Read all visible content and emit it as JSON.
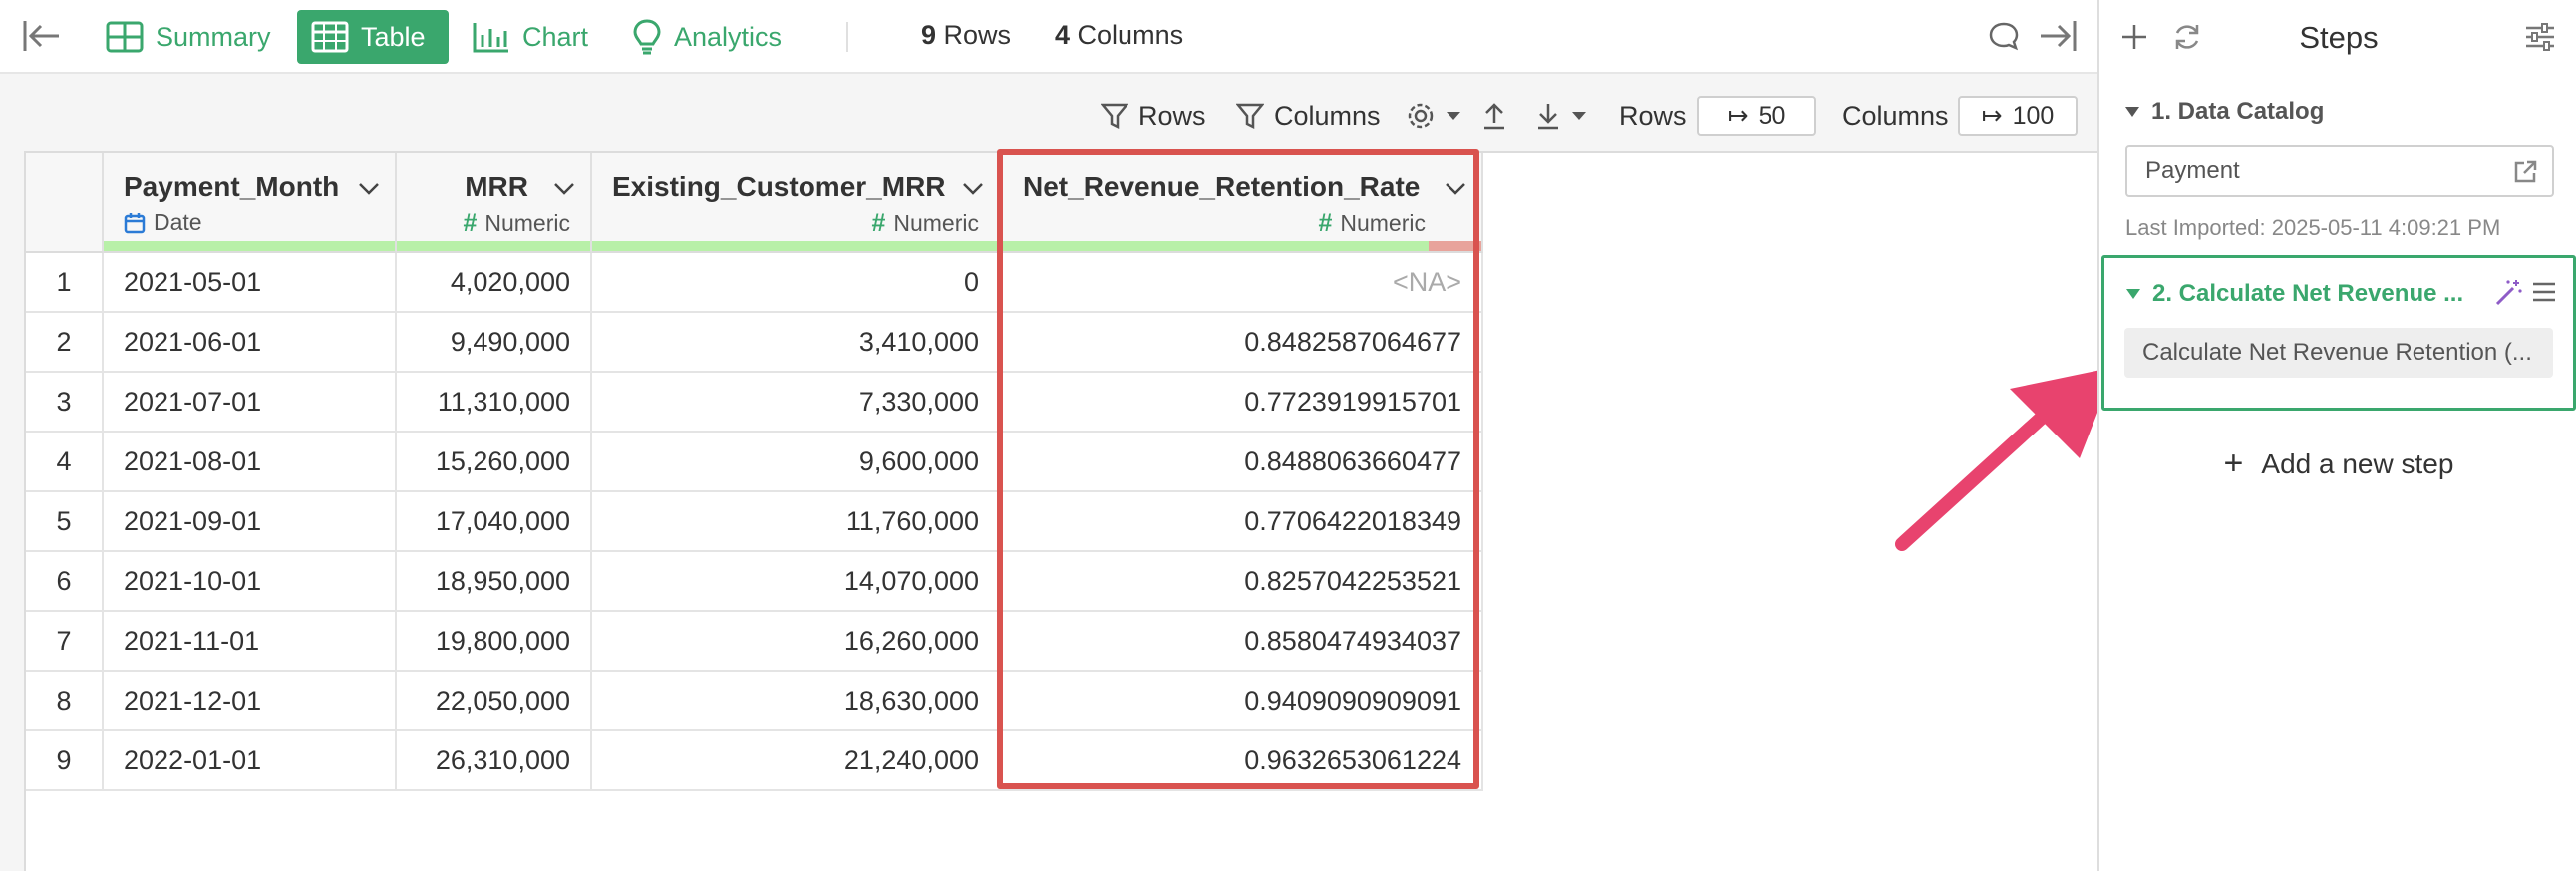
{
  "topbar": {
    "tabs": [
      {
        "label": "Summary",
        "icon": "summary-grid-icon"
      },
      {
        "label": "Table",
        "icon": "table-icon"
      },
      {
        "label": "Chart",
        "icon": "bar-chart-icon"
      },
      {
        "label": "Analytics",
        "icon": "lightbulb-icon"
      }
    ],
    "active_tab": "Table",
    "rows_count": "9",
    "rows_label": "Rows",
    "columns_count": "4",
    "columns_label": "Columns"
  },
  "toolbar": {
    "rows_filter": "Rows",
    "columns_filter": "Columns",
    "rows_label": "Rows",
    "rows_value": "50",
    "columns_label": "Columns",
    "columns_value": "100"
  },
  "table": {
    "columns": [
      {
        "name": "Payment_Month",
        "type": "Date",
        "type_icon": "calendar-icon",
        "missing_ratio": 0
      },
      {
        "name": "MRR",
        "type": "Numeric",
        "type_icon": "hash-icon",
        "missing_ratio": 0
      },
      {
        "name": "Existing_Customer_MRR",
        "type": "Numeric",
        "type_icon": "hash-icon",
        "missing_ratio": 0
      },
      {
        "name": "Net_Revenue_Retention_Rate",
        "type": "Numeric",
        "type_icon": "hash-icon",
        "missing_ratio": 0.11
      }
    ],
    "rows": [
      {
        "n": "1",
        "month": "2021-05-01",
        "mrr": "4,020,000",
        "existing": "0",
        "nrr": "<NA>"
      },
      {
        "n": "2",
        "month": "2021-06-01",
        "mrr": "9,490,000",
        "existing": "3,410,000",
        "nrr": "0.8482587064677"
      },
      {
        "n": "3",
        "month": "2021-07-01",
        "mrr": "11,310,000",
        "existing": "7,330,000",
        "nrr": "0.7723919915701"
      },
      {
        "n": "4",
        "month": "2021-08-01",
        "mrr": "15,260,000",
        "existing": "9,600,000",
        "nrr": "0.8488063660477"
      },
      {
        "n": "5",
        "month": "2021-09-01",
        "mrr": "17,040,000",
        "existing": "11,760,000",
        "nrr": "0.7706422018349"
      },
      {
        "n": "6",
        "month": "2021-10-01",
        "mrr": "18,950,000",
        "existing": "14,070,000",
        "nrr": "0.8257042253521"
      },
      {
        "n": "7",
        "month": "2021-11-01",
        "mrr": "19,800,000",
        "existing": "16,260,000",
        "nrr": "0.8580474934037"
      },
      {
        "n": "8",
        "month": "2021-12-01",
        "mrr": "22,050,000",
        "existing": "18,630,000",
        "nrr": "0.9409090909091"
      },
      {
        "n": "9",
        "month": "2022-01-01",
        "mrr": "26,310,000",
        "existing": "21,240,000",
        "nrr": "0.9632653061224"
      }
    ],
    "highlight_color": "#d9534f"
  },
  "steps_panel": {
    "title": "Steps",
    "step1": {
      "label": "1. Data Catalog",
      "source": "Payment",
      "last_imported": "Last Imported: 2025-05-11 4:09:21 PM"
    },
    "step2": {
      "label": "2. Calculate Net Revenue ...",
      "command": "Calculate Net Revenue Retention (..."
    },
    "add_step": "Add a new step"
  },
  "colors": {
    "accent": "#3aa76d",
    "arrow": "#e8436e",
    "missing_bar": "#e8a39b",
    "valid_bar": "#b8f0a8"
  }
}
